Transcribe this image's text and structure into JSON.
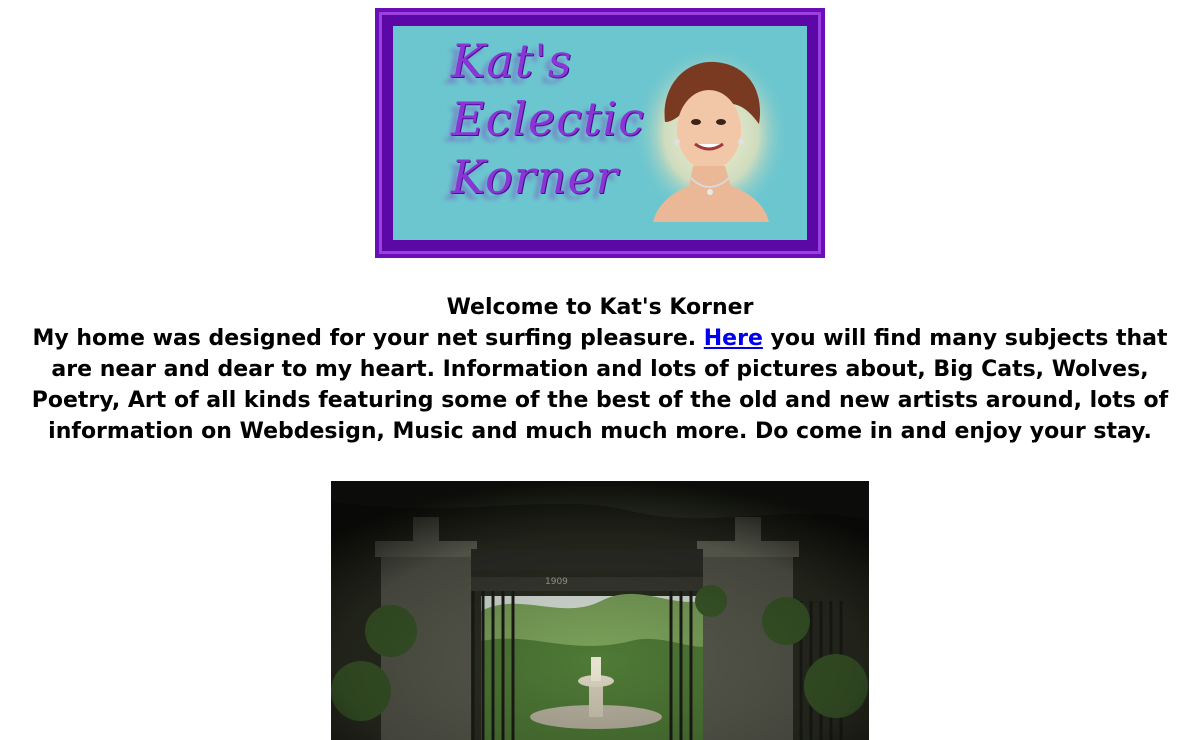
{
  "banner": {
    "title_lines": [
      "Kat's",
      "Eclectic",
      "Korner"
    ],
    "colors": {
      "outer_border": "#6a0fb8",
      "background": "#6cc6cf",
      "lettering": "#8a35d6"
    }
  },
  "welcome": {
    "heading": "Welcome to Kat's Korner",
    "intro_before_link": "My home was designed for your net surfing pleasure. ",
    "link_label": "Here",
    "intro_after_link": " you will find many subjects that are near and dear to my heart. Information and lots of pictures about, Big Cats, Wolves, Poetry, Art of all kinds featuring some of the best of the old and new artists around, lots of information on Webdesign, Music and much much more. Do come in and enjoy your stay."
  },
  "photo": {
    "gate_sign": "1909"
  }
}
